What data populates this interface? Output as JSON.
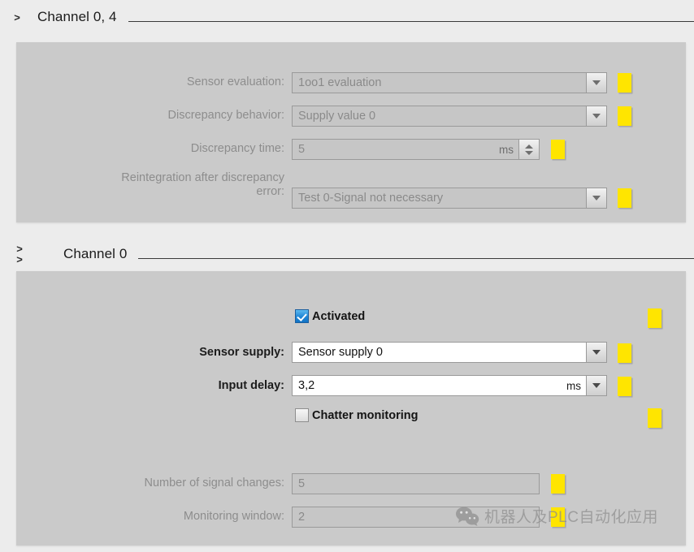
{
  "sections": [
    {
      "id": "channel_0_4",
      "title": "Channel 0, 4",
      "chevrons": ">",
      "fields": [
        {
          "label": "Sensor evaluation:",
          "value": "1oo1 evaluation",
          "control": "dropdown",
          "enabled": false,
          "marker": true
        },
        {
          "label": "Discrepancy behavior:",
          "value": "Supply value 0",
          "control": "dropdown",
          "enabled": false,
          "marker": true
        },
        {
          "label": "Discrepancy time:",
          "value": "5",
          "unit": "ms",
          "control": "spinner",
          "enabled": false,
          "marker": true
        },
        {
          "label": "Reintegration after discrepancy\nerror:",
          "value": "Test 0-Signal not necessary",
          "control": "dropdown",
          "enabled": false,
          "marker": true
        }
      ]
    },
    {
      "id": "channel_0",
      "title": "Channel 0",
      "chevrons": "> >",
      "checkboxes": [
        {
          "label": "Activated",
          "checked": true,
          "marker": true
        },
        {
          "label": "Chatter monitoring",
          "checked": false,
          "marker": true
        }
      ],
      "fields": [
        {
          "label": "Sensor supply:",
          "value": "Sensor supply 0",
          "control": "dropdown",
          "enabled": true,
          "marker": true
        },
        {
          "label": "Input delay:",
          "value": "3,2",
          "unit": "ms",
          "control": "dropdown",
          "enabled": true,
          "marker": true
        },
        {
          "label": "Number of signal changes:",
          "value": "5",
          "control": "plain",
          "enabled": false,
          "marker": true
        },
        {
          "label": "Monitoring window:",
          "value": "2",
          "control": "plain",
          "enabled": false,
          "marker": true
        }
      ]
    }
  ],
  "watermark": {
    "text": "机器人及PLC自动化应用",
    "logo": "wechat-icon"
  },
  "colors": {
    "page_background": "#ececec",
    "panel_background": "#cacaca",
    "marker_yellow": "#ffe500",
    "checkbox_blue": "#1f86d6",
    "disabled_text": "#8d8d8d"
  }
}
